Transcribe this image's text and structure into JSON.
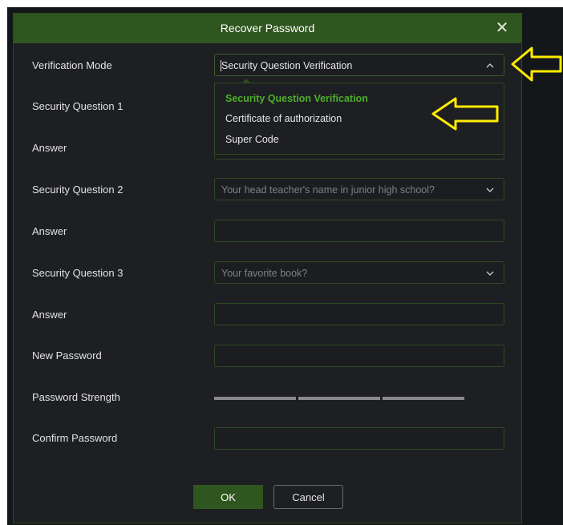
{
  "dialog": {
    "title": "Recover Password",
    "close_icon": "close-icon"
  },
  "form": {
    "verification_mode_label": "Verification Mode",
    "verification_mode_value": "Security Question Verification",
    "security_question_1_label": "Security Question 1",
    "answer_1_label": "Answer",
    "security_question_2_label": "Security Question 2",
    "security_question_2_value": "Your head teacher's name in junior high school?",
    "answer_2_label": "Answer",
    "security_question_3_label": "Security Question 3",
    "security_question_3_value": "Your favorite book?",
    "answer_3_label": "Answer",
    "new_password_label": "New Password",
    "password_strength_label": "Password Strength",
    "confirm_password_label": "Confirm Password"
  },
  "dropdown": {
    "options": [
      {
        "label": "Security Question Verification",
        "selected": true
      },
      {
        "label": "Certificate of authorization",
        "selected": false
      },
      {
        "label": "Super Code",
        "selected": false
      }
    ]
  },
  "buttons": {
    "ok_label": "OK",
    "cancel_label": "Cancel"
  },
  "colors": {
    "accent": "#2f561f",
    "selected_option": "#4dae2b",
    "annotation_arrow": "#ffec00",
    "background": "#1d1f22"
  }
}
